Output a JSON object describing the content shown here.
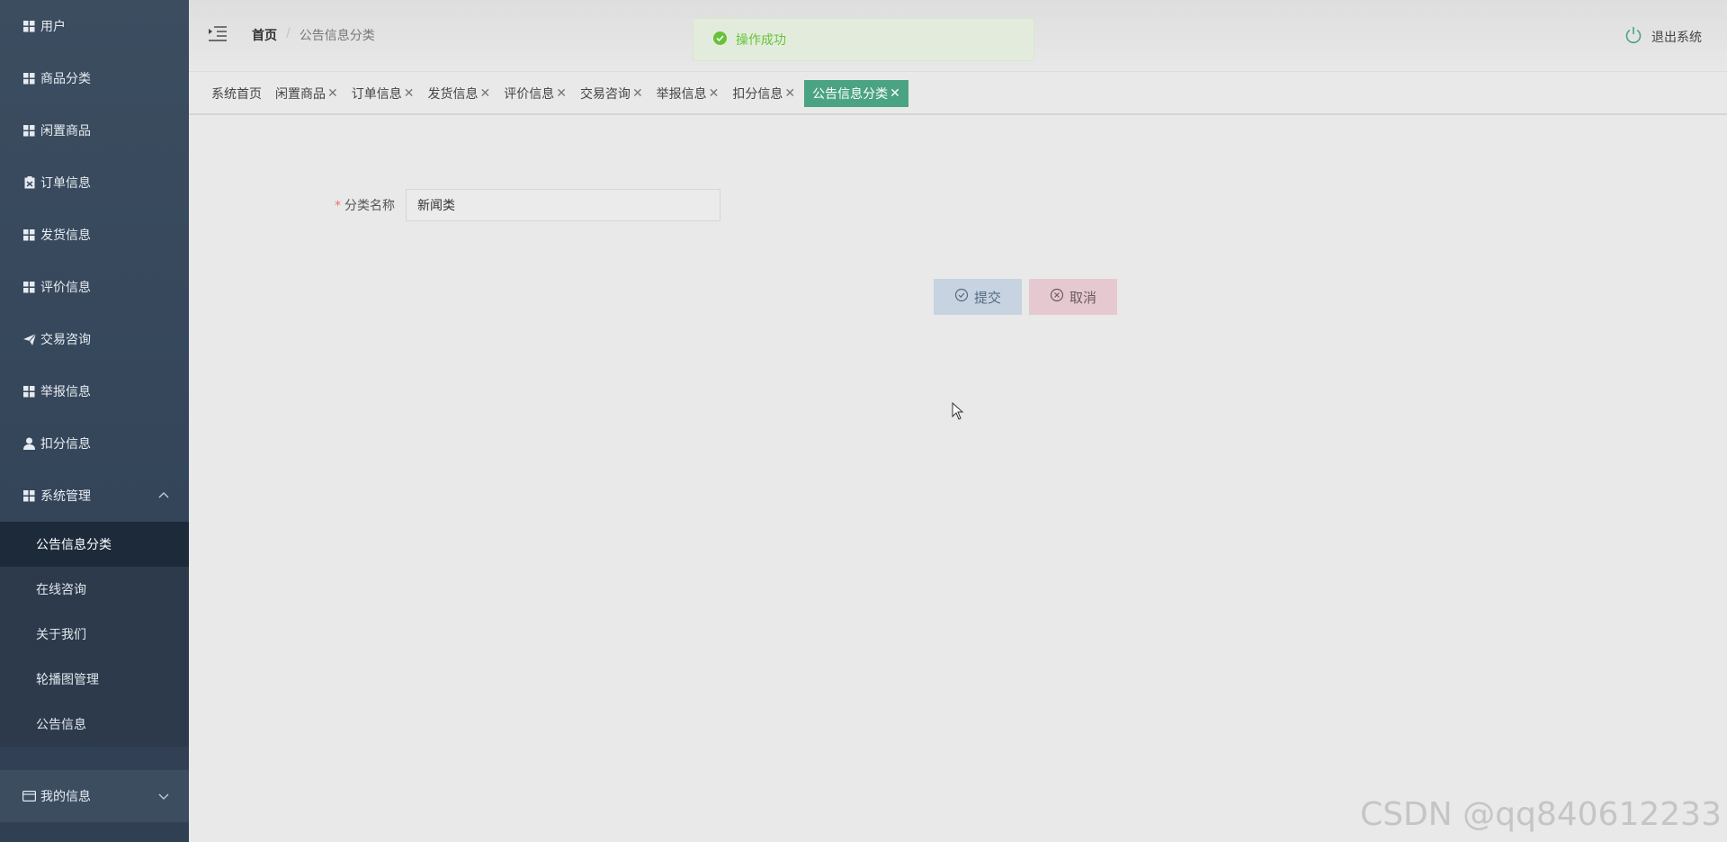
{
  "sidebar": {
    "items": [
      {
        "label": "用户",
        "icon": "grid-icon"
      },
      {
        "label": "商品分类",
        "icon": "grid-icon"
      },
      {
        "label": "闲置商品",
        "icon": "grid-icon"
      },
      {
        "label": "订单信息",
        "icon": "clipboard-icon"
      },
      {
        "label": "发货信息",
        "icon": "grid-icon"
      },
      {
        "label": "评价信息",
        "icon": "grid-icon"
      },
      {
        "label": "交易咨询",
        "icon": "paper-plane-icon"
      },
      {
        "label": "举报信息",
        "icon": "grid-icon"
      },
      {
        "label": "扣分信息",
        "icon": "user-icon"
      },
      {
        "label": "系统管理",
        "icon": "grid-icon"
      }
    ],
    "system_submenu": [
      {
        "label": "公告信息分类",
        "active": true
      },
      {
        "label": "在线咨询"
      },
      {
        "label": "关于我们"
      },
      {
        "label": "轮播图管理"
      },
      {
        "label": "公告信息"
      }
    ],
    "my_info": {
      "label": "我的信息",
      "icon": "card-icon"
    }
  },
  "header": {
    "breadcrumb_home": "首页",
    "breadcrumb_sep": "/",
    "breadcrumb_current": "公告信息分类",
    "logout_label": "退出系统"
  },
  "toast": {
    "message": "操作成功"
  },
  "tabs": [
    {
      "label": "系统首页",
      "closable": false
    },
    {
      "label": "闲置商品",
      "closable": true
    },
    {
      "label": "订单信息",
      "closable": true
    },
    {
      "label": "发货信息",
      "closable": true
    },
    {
      "label": "评价信息",
      "closable": true
    },
    {
      "label": "交易咨询",
      "closable": true
    },
    {
      "label": "举报信息",
      "closable": true
    },
    {
      "label": "扣分信息",
      "closable": true
    },
    {
      "label": "公告信息分类",
      "closable": true,
      "active": true
    }
  ],
  "tab_close_glyph": "✕",
  "form": {
    "required_mark": "*",
    "category_label": "分类名称",
    "category_value": "新闻类",
    "submit_label": "提交",
    "cancel_label": "取消"
  },
  "watermark": "CSDN @qq840612233",
  "colors": {
    "accent": "#4aa383",
    "success": "#67c23a",
    "sidebar": "#3c4d60"
  }
}
